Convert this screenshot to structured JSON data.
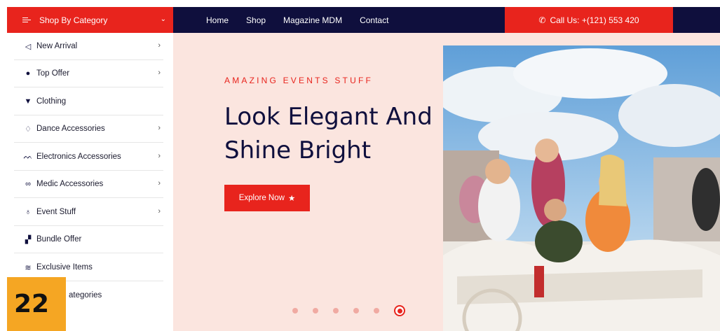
{
  "header": {
    "category_button": "Shop By Category",
    "nav": [
      "Home",
      "Shop",
      "Magazine MDM",
      "Contact"
    ],
    "call": "Call Us: +(121) 553 420"
  },
  "sidebar": {
    "items": [
      {
        "label": "New Arrival",
        "icon": "megaphone-icon",
        "has_arrow": true
      },
      {
        "label": "Top Offer",
        "icon": "bag-icon",
        "has_arrow": true
      },
      {
        "label": "Clothing",
        "icon": "tshirt-icon",
        "has_arrow": false
      },
      {
        "label": "Dance Accessories",
        "icon": "diamond-icon",
        "has_arrow": true
      },
      {
        "label": "Electronics Accessories",
        "icon": "people-icon",
        "has_arrow": true
      },
      {
        "label": "Medic Accessories",
        "icon": "binoculars-icon",
        "has_arrow": true
      },
      {
        "label": "Event Stuff",
        "icon": "lightbulb-icon",
        "has_arrow": true
      },
      {
        "label": "Bundle Offer",
        "icon": "boxes-icon",
        "has_arrow": false
      },
      {
        "label": "Exclusive Items",
        "icon": "layers-icon",
        "has_arrow": false
      },
      {
        "label": "ategories",
        "icon": "",
        "has_arrow": false
      }
    ]
  },
  "hero": {
    "eyebrow": "AMAZING EVENTS STUFF",
    "headline": "Look Elegant And Shine Bright",
    "button": "Explore Now",
    "slides": 6,
    "active_slide": 6
  },
  "badge": "22",
  "colors": {
    "accent": "#e8241d",
    "navy": "#0f0f3d",
    "hero_bg": "#fbe5df",
    "badge": "#f5a623"
  }
}
